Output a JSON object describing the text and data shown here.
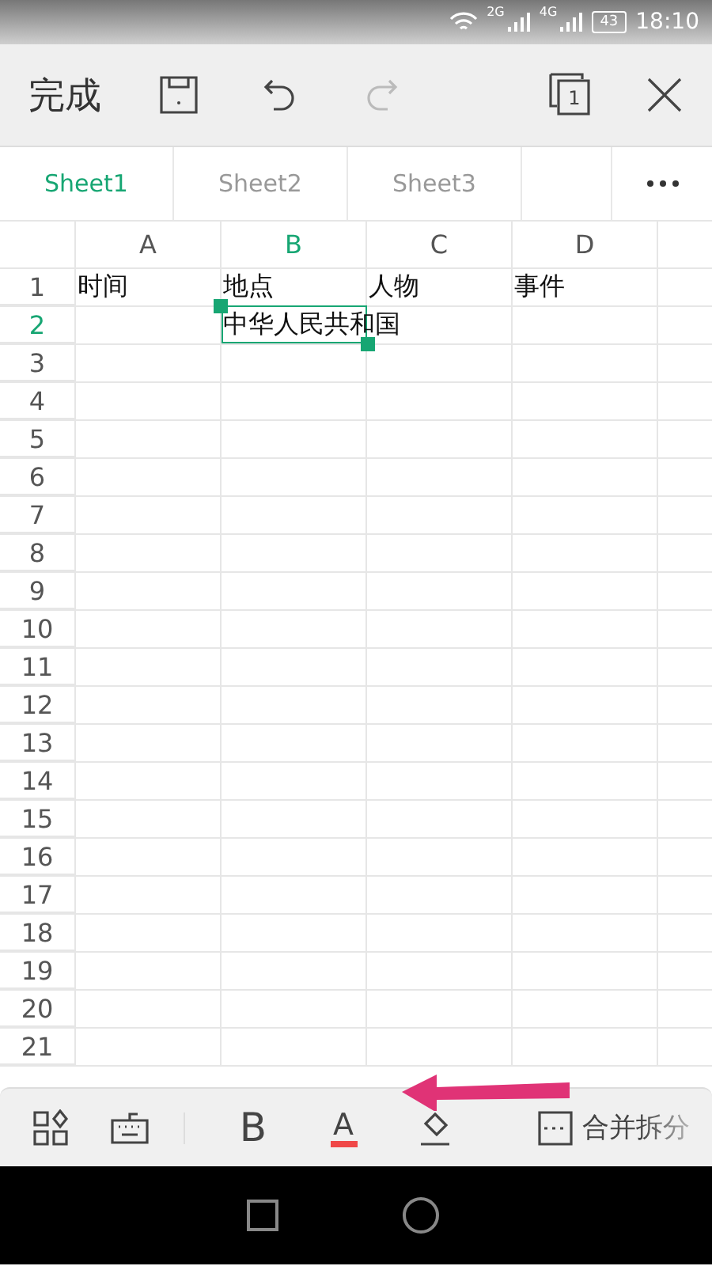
{
  "status_bar": {
    "network_1": "2G",
    "network_2": "4G",
    "battery": "43",
    "time": "18:10"
  },
  "toolbar": {
    "done": "完成",
    "sheet_count": "1",
    "redo_disabled": true
  },
  "sheet_tabs": [
    {
      "label": "Sheet1",
      "selected": true
    },
    {
      "label": "Sheet2",
      "selected": false
    },
    {
      "label": "Sheet3",
      "selected": false
    }
  ],
  "columns": [
    {
      "label": "A",
      "selected": false
    },
    {
      "label": "B",
      "selected": true
    },
    {
      "label": "C",
      "selected": false
    },
    {
      "label": "D",
      "selected": false
    }
  ],
  "rows": [
    {
      "label": "1",
      "selected": false,
      "cells": [
        {
          "text": "时间",
          "selected": false
        },
        {
          "text": "地点",
          "selected": false
        },
        {
          "text": "人物",
          "selected": false
        },
        {
          "text": "事件",
          "selected": false
        }
      ]
    },
    {
      "label": "2",
      "selected": true,
      "cells": [
        null,
        {
          "text": "中华人民共和国",
          "selected": true
        }
      ]
    },
    {
      "label": "3",
      "selected": false
    },
    {
      "label": "4",
      "selected": false
    },
    {
      "label": "5",
      "selected": false
    },
    {
      "label": "6",
      "selected": false
    },
    {
      "label": "7",
      "selected": false
    },
    {
      "label": "8",
      "selected": false
    },
    {
      "label": "9",
      "selected": false
    },
    {
      "label": "10",
      "selected": false
    },
    {
      "label": "11",
      "selected": false
    },
    {
      "label": "12",
      "selected": false
    },
    {
      "label": "13",
      "selected": false
    },
    {
      "label": "14",
      "selected": false
    },
    {
      "label": "15",
      "selected": false
    },
    {
      "label": "16",
      "selected": false
    },
    {
      "label": "17",
      "selected": false
    },
    {
      "label": "18",
      "selected": false
    },
    {
      "label": "19",
      "selected": false
    },
    {
      "label": "20",
      "selected": false
    },
    {
      "label": "21",
      "selected": false
    }
  ],
  "bottom_toolbar": {
    "bold": "B",
    "font_color": "A",
    "merge": "合并拆分"
  }
}
